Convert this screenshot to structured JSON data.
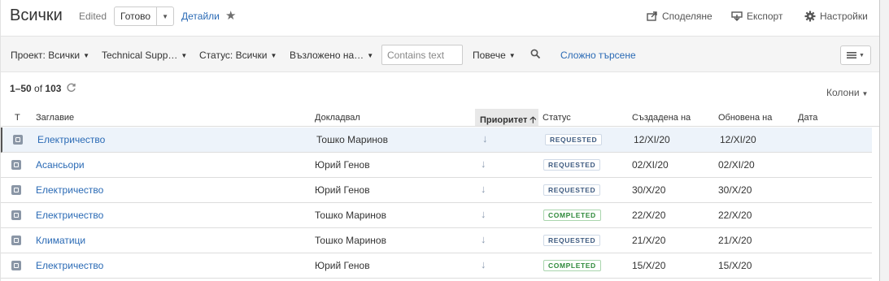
{
  "header": {
    "title": "Всички",
    "edited": "Edited",
    "status_button": "Готово",
    "details_link": "Детайли",
    "actions": [
      {
        "label": "Споделяне",
        "icon": "share-icon"
      },
      {
        "label": "Експорт",
        "icon": "export-icon"
      },
      {
        "label": "Настройки",
        "icon": "gear-icon"
      }
    ]
  },
  "toolbar": {
    "project": "Проект: Всички",
    "type": "Technical Supp…",
    "status": "Статус: Всички",
    "assigned": "Възложено на…",
    "contains_placeholder": "Contains text",
    "more": "Повече",
    "advanced_search": "Сложно търсене"
  },
  "results": {
    "range": "1–50",
    "of": "of",
    "total": "103",
    "columns_button": "Колони"
  },
  "table": {
    "headers": {
      "type": "T",
      "summary": "Заглавие",
      "reporter": "Докладвал",
      "priority": "Приоритет",
      "status": "Статус",
      "created": "Създадена на",
      "updated": "Обновена на",
      "date": "Дата"
    },
    "rows": [
      {
        "summary": "Електричество",
        "reporter": "Тошко Маринов",
        "status": "REQUESTED",
        "created": "12/XI/20",
        "updated": "12/XI/20",
        "selected": true
      },
      {
        "summary": "Асансьори",
        "reporter": "Юрий Генов",
        "status": "REQUESTED",
        "created": "02/XI/20",
        "updated": "02/XI/20",
        "selected": false
      },
      {
        "summary": "Електричество",
        "reporter": "Юрий Генов",
        "status": "REQUESTED",
        "created": "30/X/20",
        "updated": "30/X/20",
        "selected": false
      },
      {
        "summary": "Електричество",
        "reporter": "Тошко Маринов",
        "status": "COMPLETED",
        "created": "22/X/20",
        "updated": "22/X/20",
        "selected": false
      },
      {
        "summary": "Климатици",
        "reporter": "Тошко Маринов",
        "status": "REQUESTED",
        "created": "21/X/20",
        "updated": "21/X/20",
        "selected": false
      },
      {
        "summary": "Електричество",
        "reporter": "Юрий Генов",
        "status": "COMPLETED",
        "created": "15/X/20",
        "updated": "15/X/20",
        "selected": false
      }
    ]
  },
  "colors": {
    "link": "#2a6ab5",
    "requested": "#3d5a80",
    "completed": "#2f8a3b",
    "selected_row": "#edf3fa"
  }
}
